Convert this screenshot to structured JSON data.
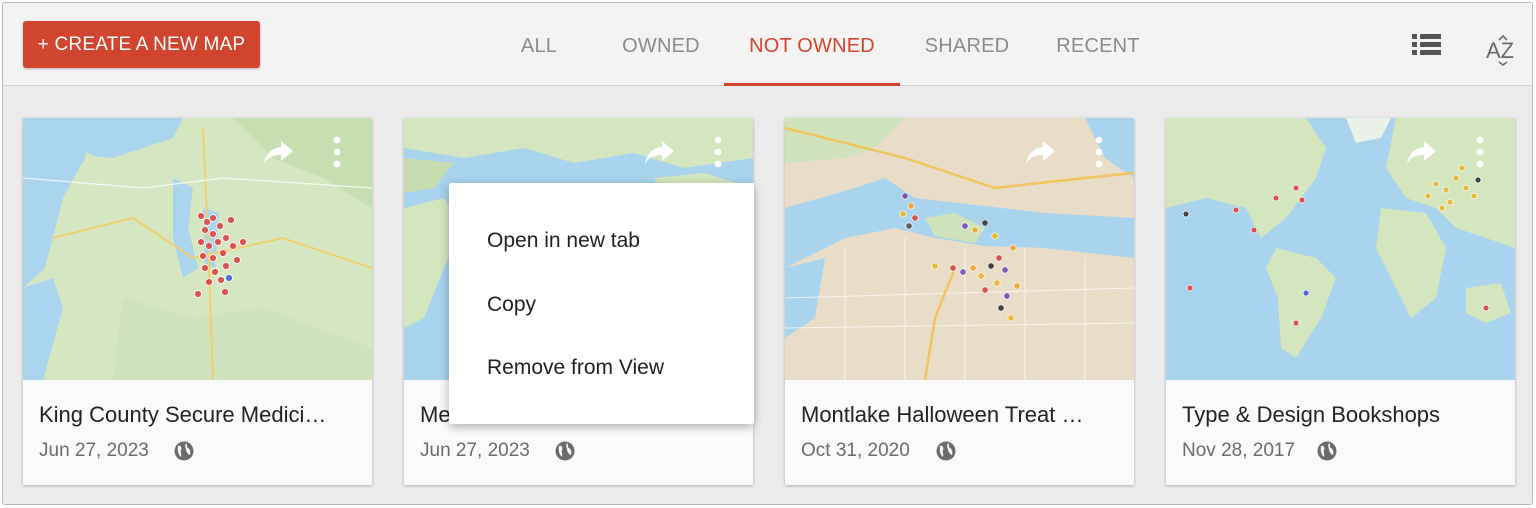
{
  "toolbar": {
    "create_label": "+ CREATE A NEW MAP",
    "tabs": [
      {
        "label": "ALL",
        "active": false
      },
      {
        "label": "OWNED",
        "active": false
      },
      {
        "label": "NOT OWNED",
        "active": true
      },
      {
        "label": "SHARED",
        "active": false
      },
      {
        "label": "RECENT",
        "active": false
      }
    ],
    "view_icon": "list-view-icon",
    "sort_icon": "sort-az-icon",
    "sort_label": "AZ"
  },
  "cards": [
    {
      "title": "King County Secure Medici…",
      "date": "Jun 27, 2023",
      "visibility_icon": "globe-icon"
    },
    {
      "title": "Me…",
      "date": "Jun 27, 2023",
      "visibility_icon": "globe-icon"
    },
    {
      "title": "Montlake Halloween Treat …",
      "date": "Oct 31, 2020",
      "visibility_icon": "globe-icon"
    },
    {
      "title": "Type & Design Bookshops",
      "date": "Nov 28, 2017",
      "visibility_icon": "globe-icon"
    }
  ],
  "context_menu": {
    "items": [
      "Open in new tab",
      "Copy",
      "Remove from View"
    ]
  },
  "colors": {
    "accent": "#d1452f",
    "tab_inactive": "#8a8a8a",
    "map_water": "#a7d3ee",
    "map_land": "#d3e6bd",
    "map_land_street": "#e8dcc6"
  }
}
